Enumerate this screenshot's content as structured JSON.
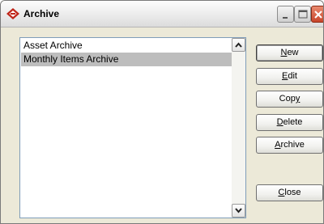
{
  "window": {
    "title": "Archive"
  },
  "titlebar_buttons": {
    "minimize": "minimize",
    "maximize": "maximize",
    "close": "close"
  },
  "list": {
    "items": [
      {
        "label": "Asset Archive",
        "selected": false
      },
      {
        "label": "Monthly Items Archive",
        "selected": true
      }
    ]
  },
  "buttons": {
    "new": {
      "access": "N",
      "rest": "ew"
    },
    "edit": {
      "access": "E",
      "rest": "dit"
    },
    "copy": {
      "pre": "Cop",
      "access": "y"
    },
    "delete": {
      "access": "D",
      "rest": "elete"
    },
    "archive": {
      "access": "A",
      "rest": "rchive"
    },
    "close": {
      "access": "C",
      "rest": "lose"
    }
  },
  "icons": {
    "app": "red-diamond-icon",
    "scroll_up": "chevron-up-icon",
    "scroll_down": "chevron-down-icon"
  },
  "colors": {
    "selection": "#bdbdbd",
    "close_button": "#c8452a"
  }
}
